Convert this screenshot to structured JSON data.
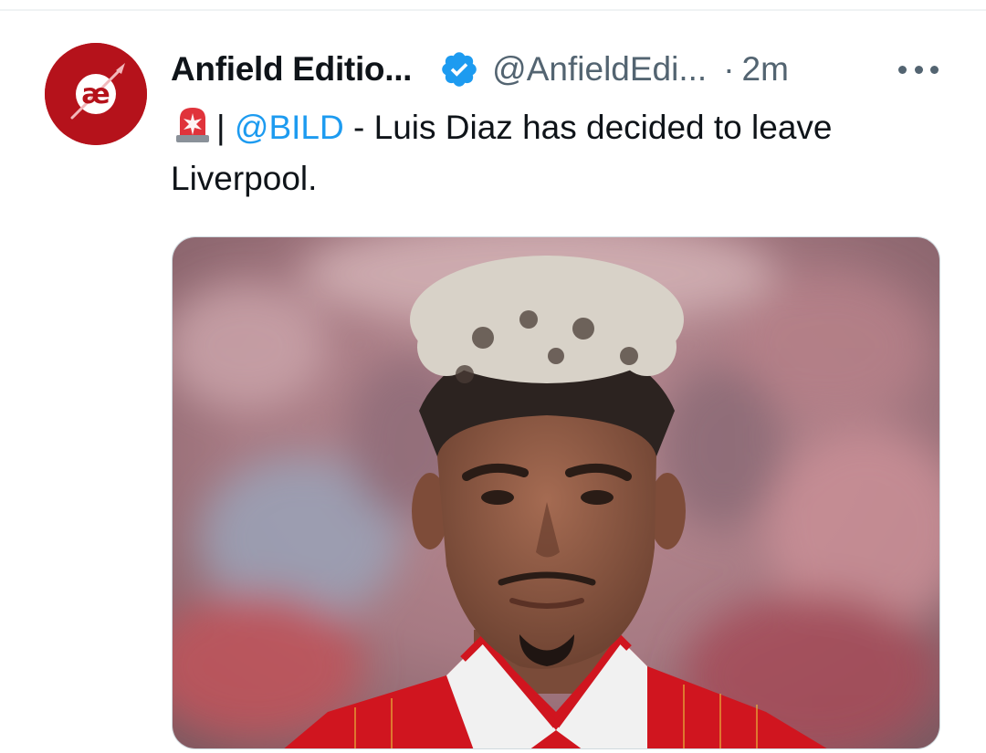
{
  "tweet": {
    "author": {
      "display_name": "Anfield Editio...",
      "handle": "@AnfieldEdi...",
      "verified": true,
      "avatar_text": "æ"
    },
    "separator": "·",
    "timestamp": "2m",
    "text": {
      "divider": "|",
      "mention": "@BILD",
      "body_line1": " - Luis Diaz has decided to leave",
      "body_line2": "Liverpool."
    },
    "media": {
      "alt_icon": "player-photo"
    }
  },
  "icons": {
    "verified": "verified-badge-icon",
    "more": "more-options-icon",
    "siren": "siren-emoji-icon"
  },
  "colors": {
    "link": "#1d9bf0",
    "verified": "#1d9bf0",
    "secondary_text": "#536471",
    "avatar_bg": "#b5121b",
    "kit_red": "#d0151f"
  }
}
